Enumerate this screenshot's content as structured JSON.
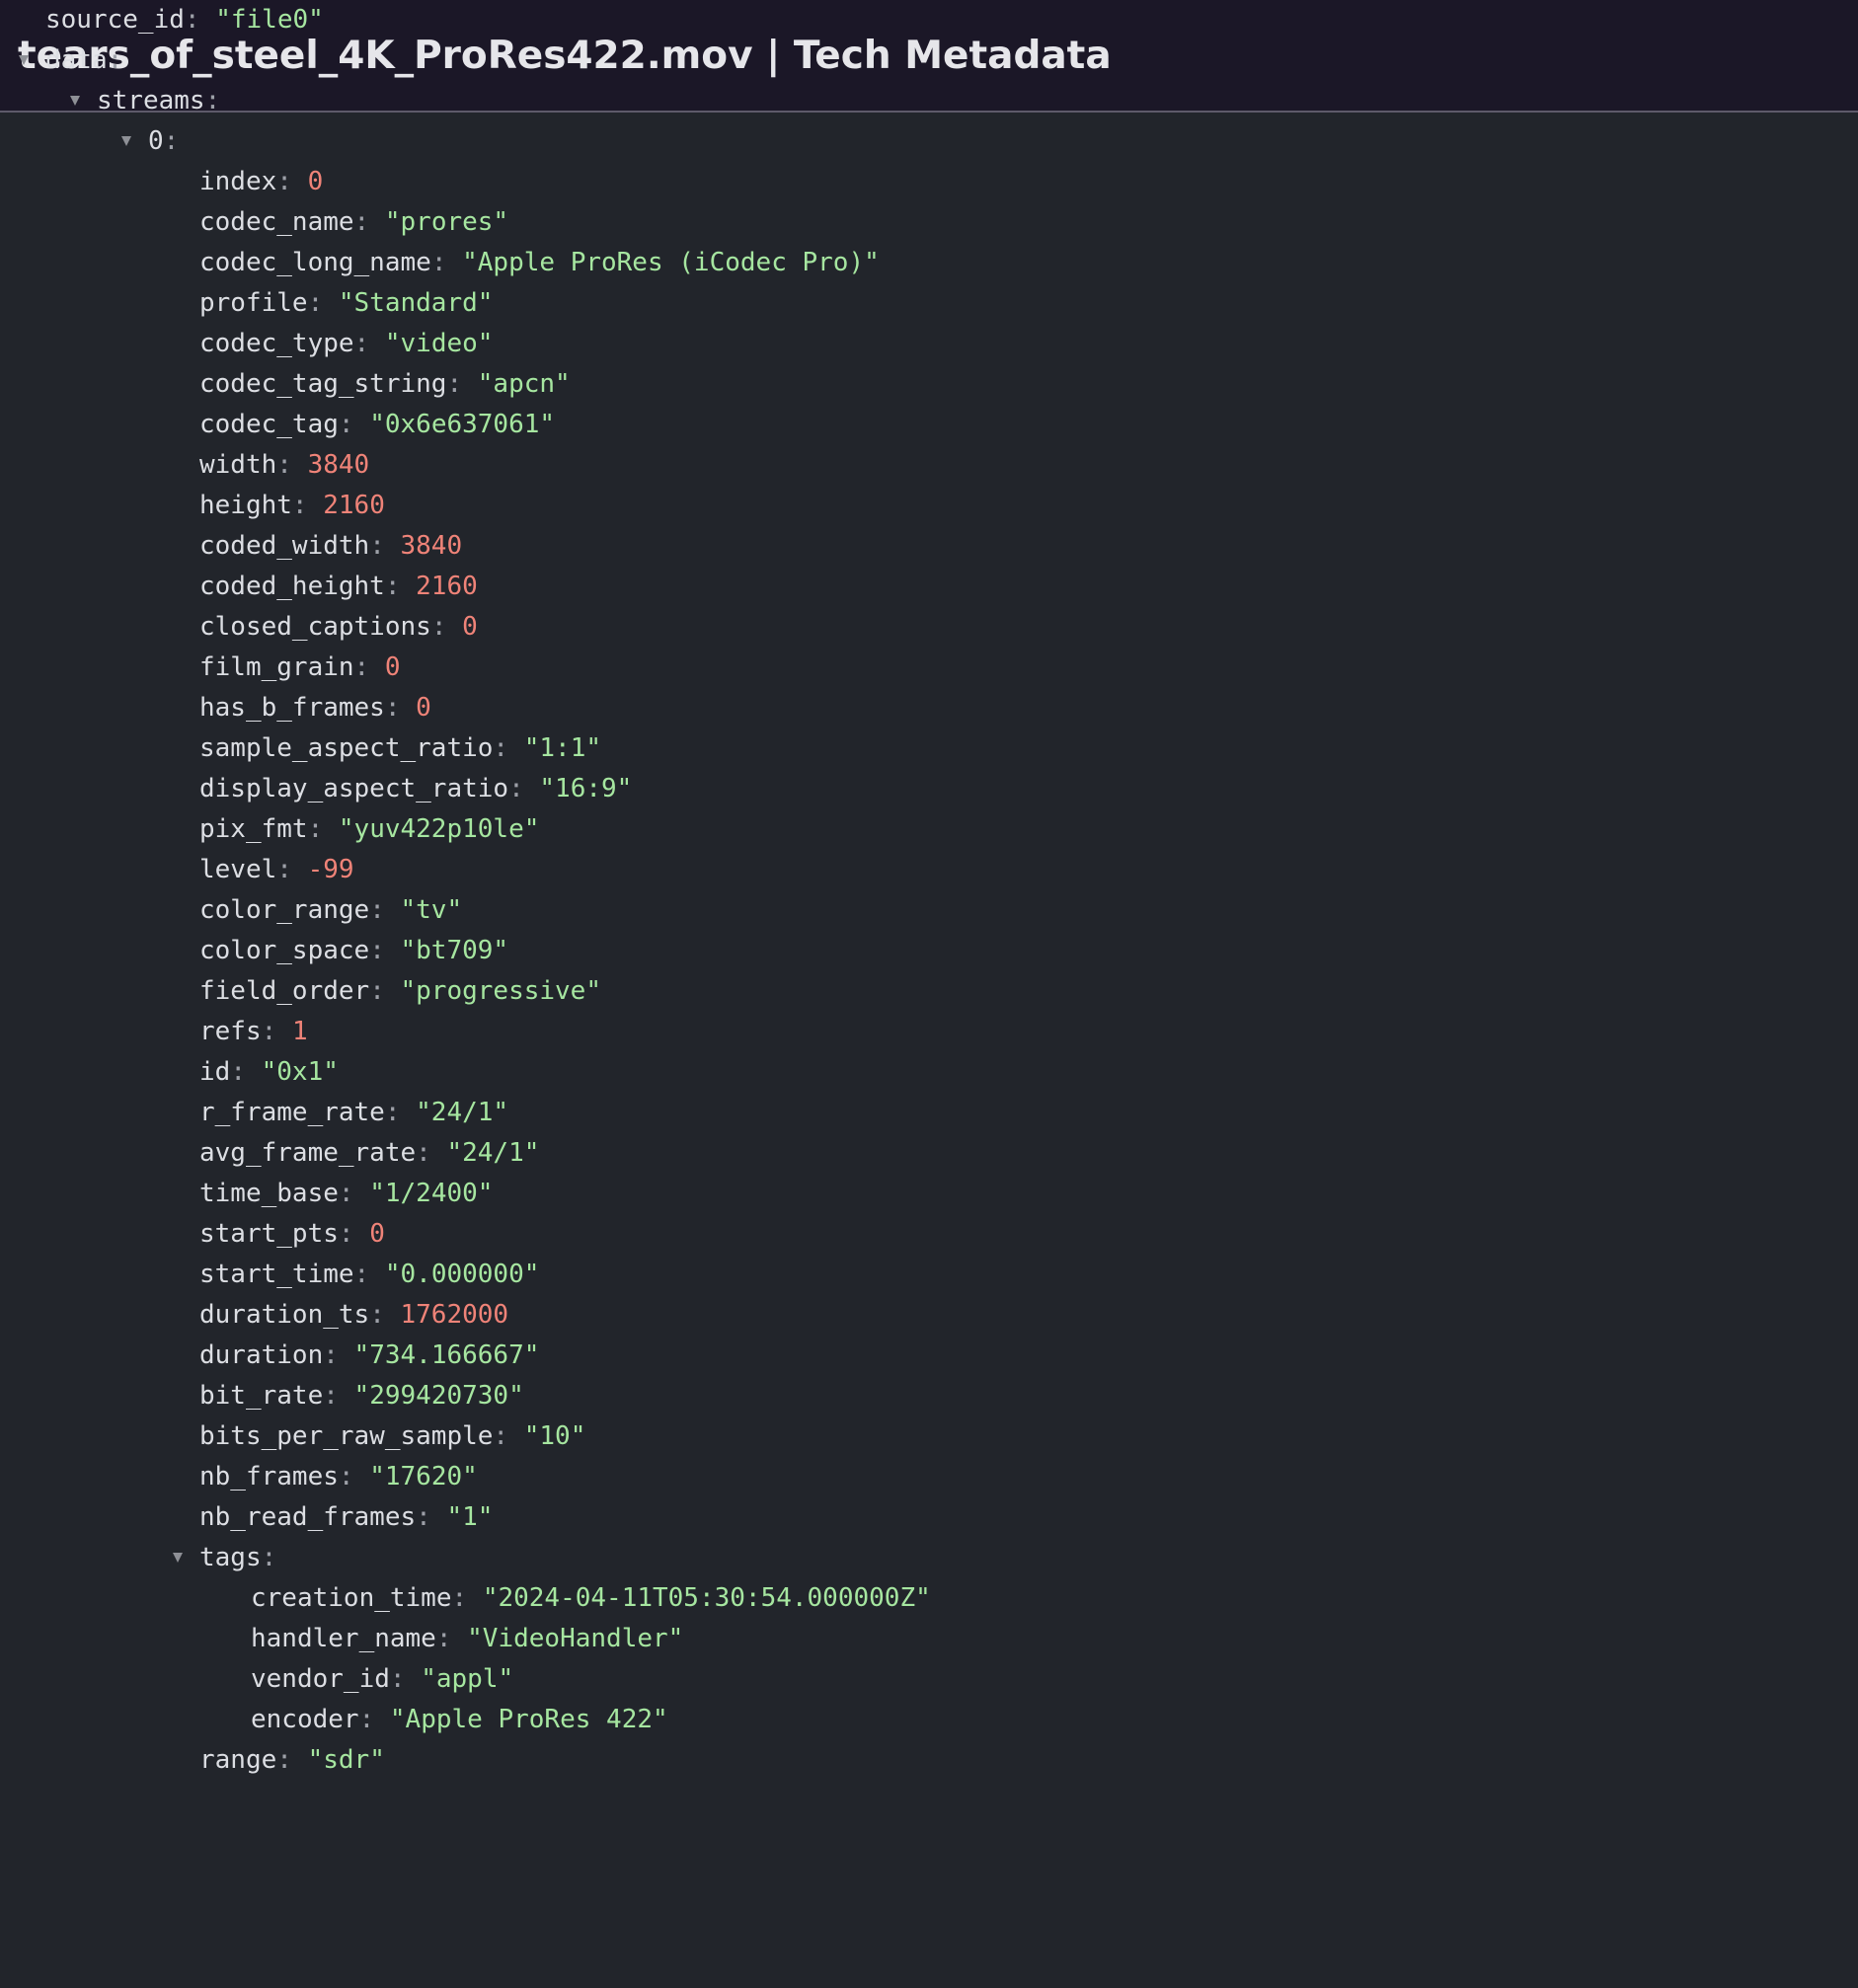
{
  "window": {
    "title": "tears_of_steel_4K_ProRes422.mov | Tech Metadata"
  },
  "rows": [
    {
      "depth": 0,
      "key": "source_id",
      "value": "\"file0\"",
      "type": "str"
    },
    {
      "depth": 0,
      "key": "data",
      "value": "",
      "type": "obj",
      "expanded": true
    },
    {
      "depth": 1,
      "key": "streams",
      "value": "",
      "type": "obj",
      "expanded": true
    },
    {
      "depth": 2,
      "key": "0",
      "value": "",
      "type": "obj",
      "expanded": true
    },
    {
      "depth": 3,
      "key": "index",
      "value": "0",
      "type": "num"
    },
    {
      "depth": 3,
      "key": "codec_name",
      "value": "\"prores\"",
      "type": "str"
    },
    {
      "depth": 3,
      "key": "codec_long_name",
      "value": "\"Apple ProRes (iCodec Pro)\"",
      "type": "str"
    },
    {
      "depth": 3,
      "key": "profile",
      "value": "\"Standard\"",
      "type": "str"
    },
    {
      "depth": 3,
      "key": "codec_type",
      "value": "\"video\"",
      "type": "str"
    },
    {
      "depth": 3,
      "key": "codec_tag_string",
      "value": "\"apcn\"",
      "type": "str"
    },
    {
      "depth": 3,
      "key": "codec_tag",
      "value": "\"0x6e637061\"",
      "type": "str"
    },
    {
      "depth": 3,
      "key": "width",
      "value": "3840",
      "type": "num"
    },
    {
      "depth": 3,
      "key": "height",
      "value": "2160",
      "type": "num"
    },
    {
      "depth": 3,
      "key": "coded_width",
      "value": "3840",
      "type": "num"
    },
    {
      "depth": 3,
      "key": "coded_height",
      "value": "2160",
      "type": "num"
    },
    {
      "depth": 3,
      "key": "closed_captions",
      "value": "0",
      "type": "num"
    },
    {
      "depth": 3,
      "key": "film_grain",
      "value": "0",
      "type": "num"
    },
    {
      "depth": 3,
      "key": "has_b_frames",
      "value": "0",
      "type": "num"
    },
    {
      "depth": 3,
      "key": "sample_aspect_ratio",
      "value": "\"1:1\"",
      "type": "str"
    },
    {
      "depth": 3,
      "key": "display_aspect_ratio",
      "value": "\"16:9\"",
      "type": "str"
    },
    {
      "depth": 3,
      "key": "pix_fmt",
      "value": "\"yuv422p10le\"",
      "type": "str"
    },
    {
      "depth": 3,
      "key": "level",
      "value": "-99",
      "type": "num"
    },
    {
      "depth": 3,
      "key": "color_range",
      "value": "\"tv\"",
      "type": "str"
    },
    {
      "depth": 3,
      "key": "color_space",
      "value": "\"bt709\"",
      "type": "str"
    },
    {
      "depth": 3,
      "key": "field_order",
      "value": "\"progressive\"",
      "type": "str"
    },
    {
      "depth": 3,
      "key": "refs",
      "value": "1",
      "type": "num"
    },
    {
      "depth": 3,
      "key": "id",
      "value": "\"0x1\"",
      "type": "str"
    },
    {
      "depth": 3,
      "key": "r_frame_rate",
      "value": "\"24/1\"",
      "type": "str"
    },
    {
      "depth": 3,
      "key": "avg_frame_rate",
      "value": "\"24/1\"",
      "type": "str"
    },
    {
      "depth": 3,
      "key": "time_base",
      "value": "\"1/2400\"",
      "type": "str"
    },
    {
      "depth": 3,
      "key": "start_pts",
      "value": "0",
      "type": "num"
    },
    {
      "depth": 3,
      "key": "start_time",
      "value": "\"0.000000\"",
      "type": "str"
    },
    {
      "depth": 3,
      "key": "duration_ts",
      "value": "1762000",
      "type": "num"
    },
    {
      "depth": 3,
      "key": "duration",
      "value": "\"734.166667\"",
      "type": "str"
    },
    {
      "depth": 3,
      "key": "bit_rate",
      "value": "\"299420730\"",
      "type": "str"
    },
    {
      "depth": 3,
      "key": "bits_per_raw_sample",
      "value": "\"10\"",
      "type": "str"
    },
    {
      "depth": 3,
      "key": "nb_frames",
      "value": "\"17620\"",
      "type": "str"
    },
    {
      "depth": 3,
      "key": "nb_read_frames",
      "value": "\"1\"",
      "type": "str"
    },
    {
      "depth": 3,
      "key": "tags",
      "value": "",
      "type": "obj",
      "expanded": true
    },
    {
      "depth": 4,
      "key": "creation_time",
      "value": "\"2024-04-11T05:30:54.000000Z\"",
      "type": "str"
    },
    {
      "depth": 4,
      "key": "handler_name",
      "value": "\"VideoHandler\"",
      "type": "str"
    },
    {
      "depth": 4,
      "key": "vendor_id",
      "value": "\"appl\"",
      "type": "str"
    },
    {
      "depth": 4,
      "key": "encoder",
      "value": "\"Apple ProRes 422\"",
      "type": "str"
    },
    {
      "depth": 3,
      "key": "range",
      "value": "\"sdr\"",
      "type": "str"
    }
  ],
  "colors": {
    "background": "#22252b",
    "title_bar": "#1b1727",
    "key": "#dcdee3",
    "string": "#a6e6a0",
    "number": "#ef8378"
  }
}
